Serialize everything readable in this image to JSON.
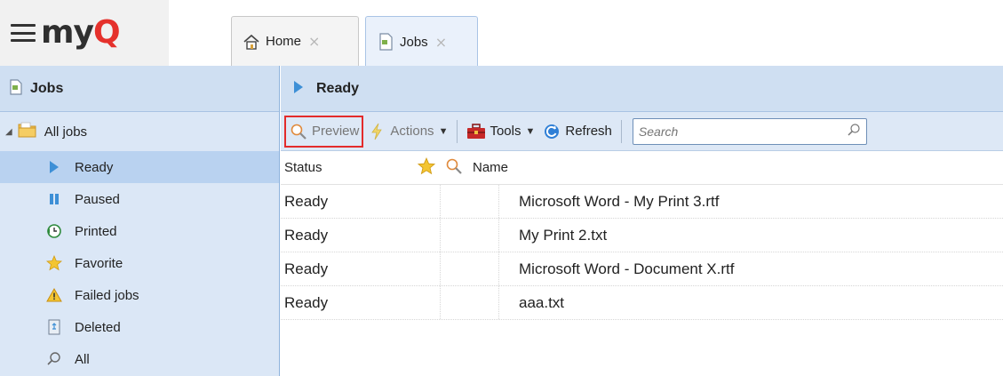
{
  "app": {
    "logo_text_main": "my",
    "logo_text_accent": "Q"
  },
  "tabs": [
    {
      "label": "Home",
      "close": "×"
    },
    {
      "label": "Jobs",
      "close": "×"
    }
  ],
  "sidebar": {
    "title": "Jobs",
    "root_label": "All jobs",
    "items": [
      {
        "label": "Ready",
        "icon": "play-triangle-icon",
        "selected": true
      },
      {
        "label": "Paused",
        "icon": "pause-icon"
      },
      {
        "label": "Printed",
        "icon": "history-clock-icon"
      },
      {
        "label": "Favorite",
        "icon": "star-icon"
      },
      {
        "label": "Failed jobs",
        "icon": "warning-icon"
      },
      {
        "label": "Deleted",
        "icon": "recycle-bin-icon"
      },
      {
        "label": "All",
        "icon": "magnifier-icon"
      }
    ]
  },
  "main": {
    "title": "Ready",
    "toolbar": {
      "preview_label": "Preview",
      "actions_label": "Actions",
      "tools_label": "Tools",
      "refresh_label": "Refresh",
      "search_placeholder": "Search"
    },
    "columns": {
      "status": "Status",
      "name": "Name"
    },
    "rows": [
      {
        "status": "Ready",
        "name": "Microsoft Word - My Print 3.rtf"
      },
      {
        "status": "Ready",
        "name": "My Print 2.txt"
      },
      {
        "status": "Ready",
        "name": "Microsoft Word - Document X.rtf"
      },
      {
        "status": "Ready",
        "name": "aaa.txt"
      }
    ]
  },
  "colors": {
    "brand_accent": "#e5312c",
    "highlight_box": "#e32b2b",
    "selected_row": "#b9d2f0"
  }
}
